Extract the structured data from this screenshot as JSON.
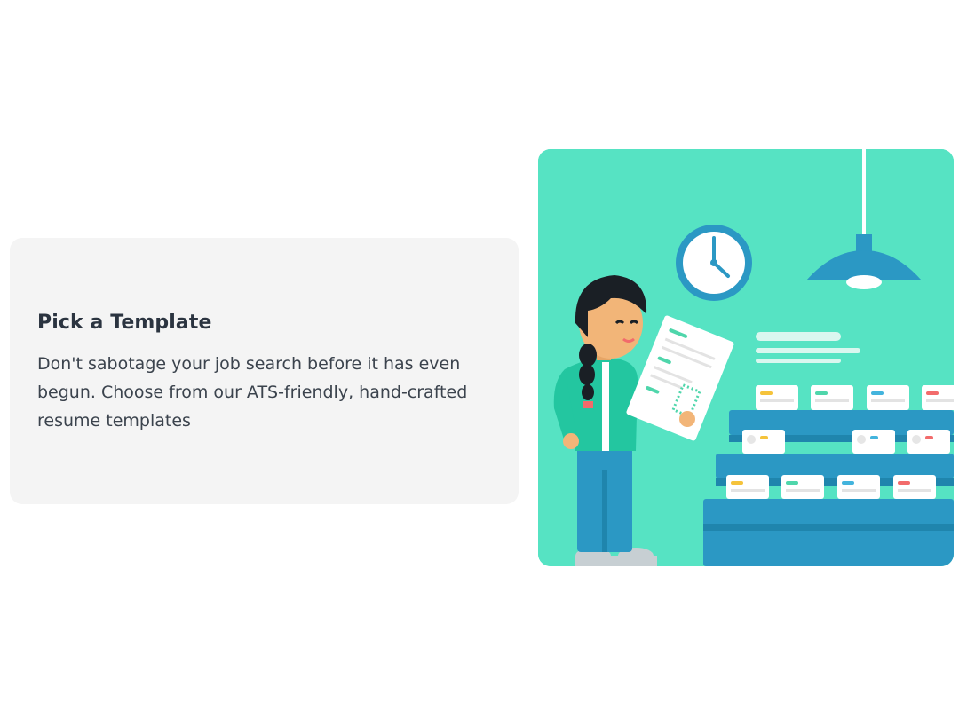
{
  "card": {
    "title": "Pick a Template",
    "description": "Don't sabotage your job search before it has even begun. Choose from our ATS-friendly, hand-crafted resume templates"
  },
  "illustration": {
    "background_color": "#56e3c3",
    "shelf_color": "#2b98c4",
    "accent_colors": [
      "#f5c33b",
      "#4fd6ab",
      "#43b4dd",
      "#f26b6b"
    ]
  }
}
